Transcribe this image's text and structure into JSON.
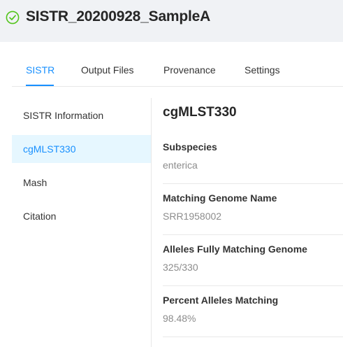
{
  "header": {
    "title": "SISTR_20200928_SampleA",
    "status_icon": "check-circle-icon",
    "status_color": "#52c41a"
  },
  "tabs": [
    {
      "label": "SISTR",
      "active": true
    },
    {
      "label": "Output Files",
      "active": false
    },
    {
      "label": "Provenance",
      "active": false
    },
    {
      "label": "Settings",
      "active": false
    }
  ],
  "menu": [
    {
      "label": "SISTR Information",
      "selected": false
    },
    {
      "label": "cgMLST330",
      "selected": true
    },
    {
      "label": "Mash",
      "selected": false
    },
    {
      "label": "Citation",
      "selected": false
    }
  ],
  "content": {
    "title": "cgMLST330",
    "fields": [
      {
        "label": "Subspecies",
        "value": "enterica"
      },
      {
        "label": "Matching Genome Name",
        "value": "SRR1958002"
      },
      {
        "label": "Alleles Fully Matching Genome",
        "value": "325/330"
      },
      {
        "label": "Percent Alleles Matching",
        "value": "98.48%"
      }
    ]
  },
  "colors": {
    "accent": "#1890ff",
    "selected_bg": "#e6f7ff",
    "success": "#52c41a"
  }
}
